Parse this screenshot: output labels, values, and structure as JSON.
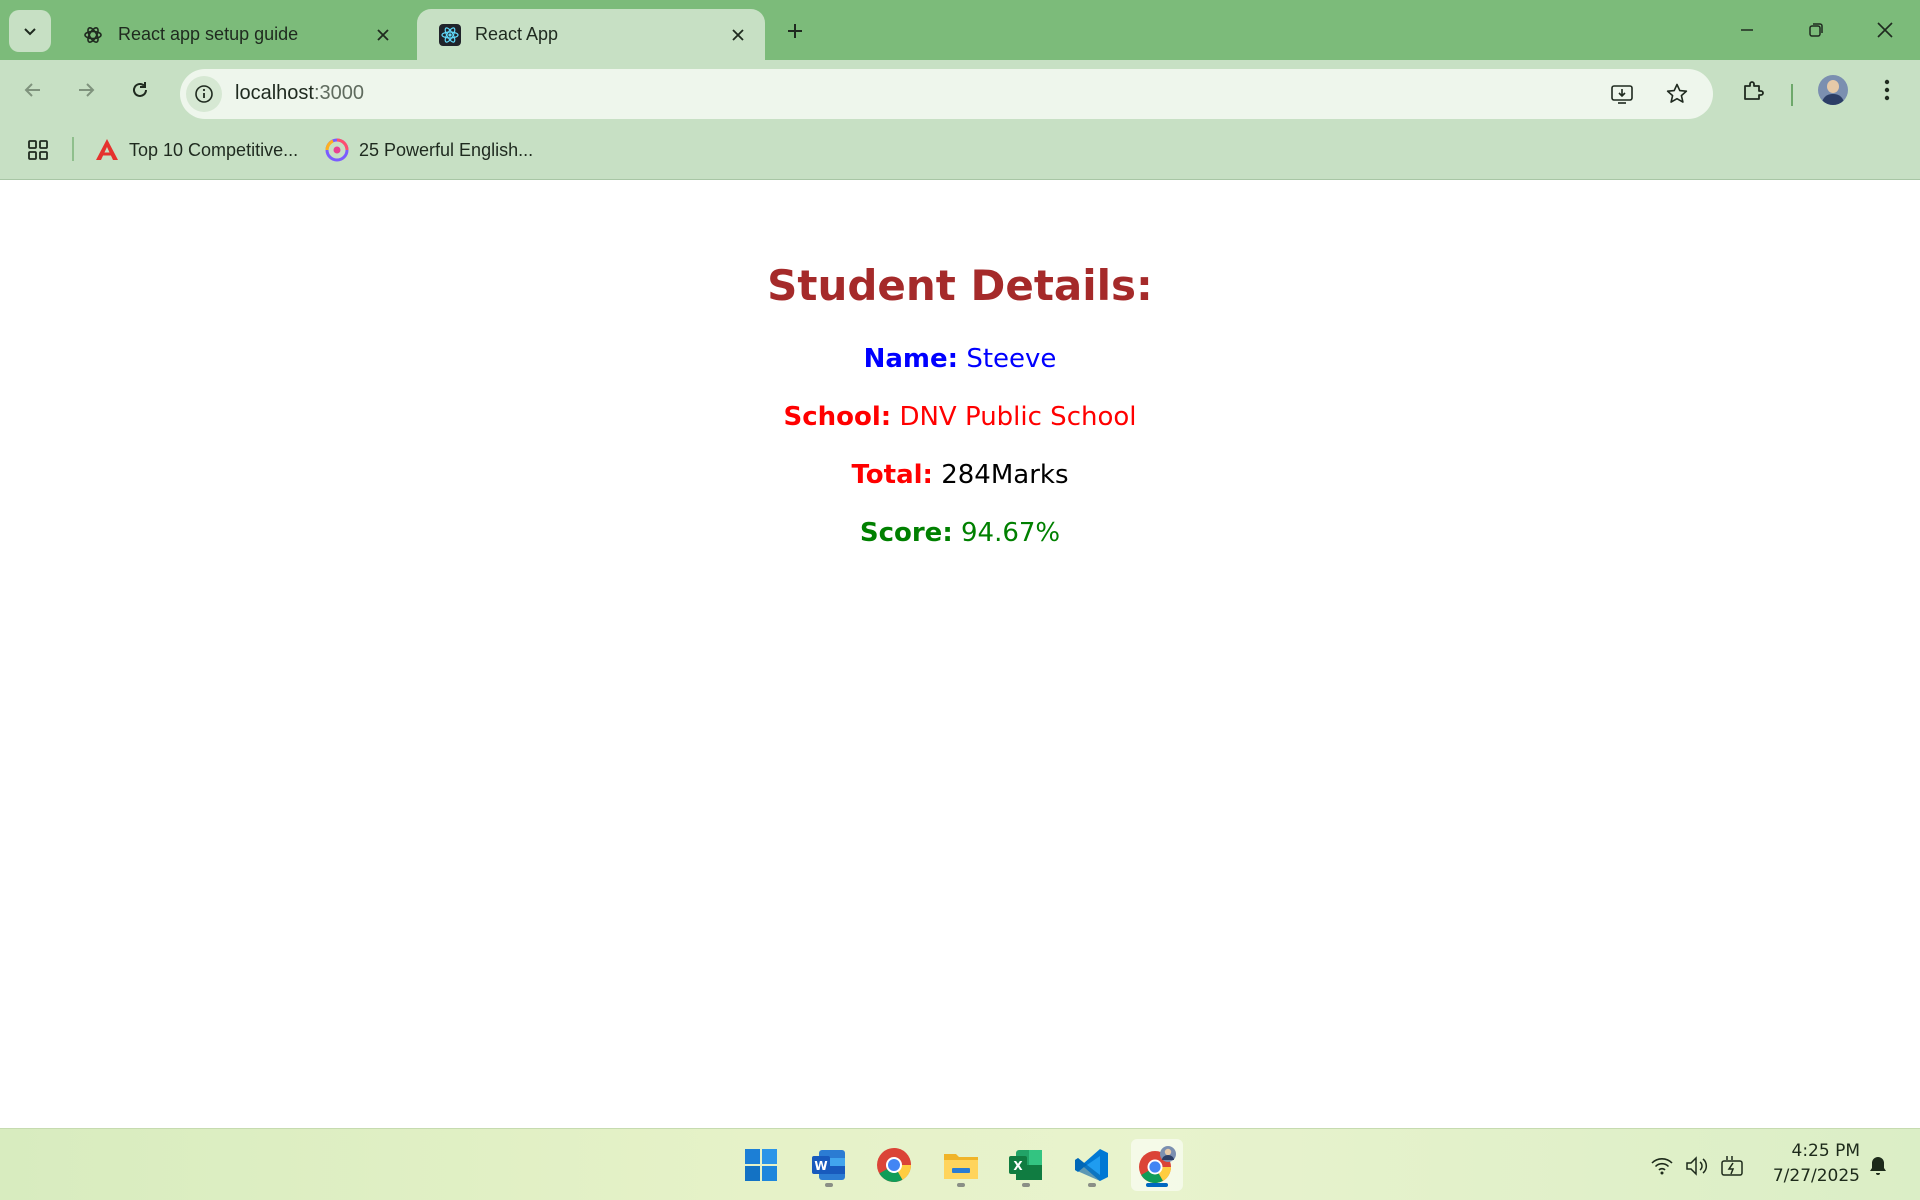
{
  "browser": {
    "tabs": [
      {
        "title": "React app setup guide",
        "active": false,
        "icon": "openai-icon"
      },
      {
        "title": "React App",
        "active": true,
        "icon": "react-icon"
      }
    ],
    "address": {
      "host": "localhost",
      "port": ":3000"
    },
    "bookmarks": [
      {
        "label": "Top 10 Competitive...",
        "icon": "red-a-logo-icon"
      },
      {
        "label": "25 Powerful English...",
        "icon": "colorful-logo-icon"
      }
    ],
    "colors": {
      "tabbar": "#7cbb7a",
      "toolbar": "#c7e0c4"
    }
  },
  "page": {
    "heading": "Student Details:",
    "rows": [
      {
        "label": "Name:",
        "value": "Steeve",
        "color": "#0000ff"
      },
      {
        "label": "School:",
        "value": "DNV Public School",
        "color": "#ff0000"
      },
      {
        "label": "Total:",
        "value": "284Marks",
        "color": "#000000"
      },
      {
        "label": "Score:",
        "value": "94.67%",
        "color": "#008000"
      }
    ],
    "heading_color": "#a52a2a"
  },
  "taskbar": {
    "apps": [
      "start-icon",
      "word-icon",
      "chrome-icon",
      "file-explorer-icon",
      "excel-icon",
      "vscode-icon",
      "chrome-profile-icon"
    ],
    "time": "4:25 PM",
    "date": "7/27/2025"
  }
}
